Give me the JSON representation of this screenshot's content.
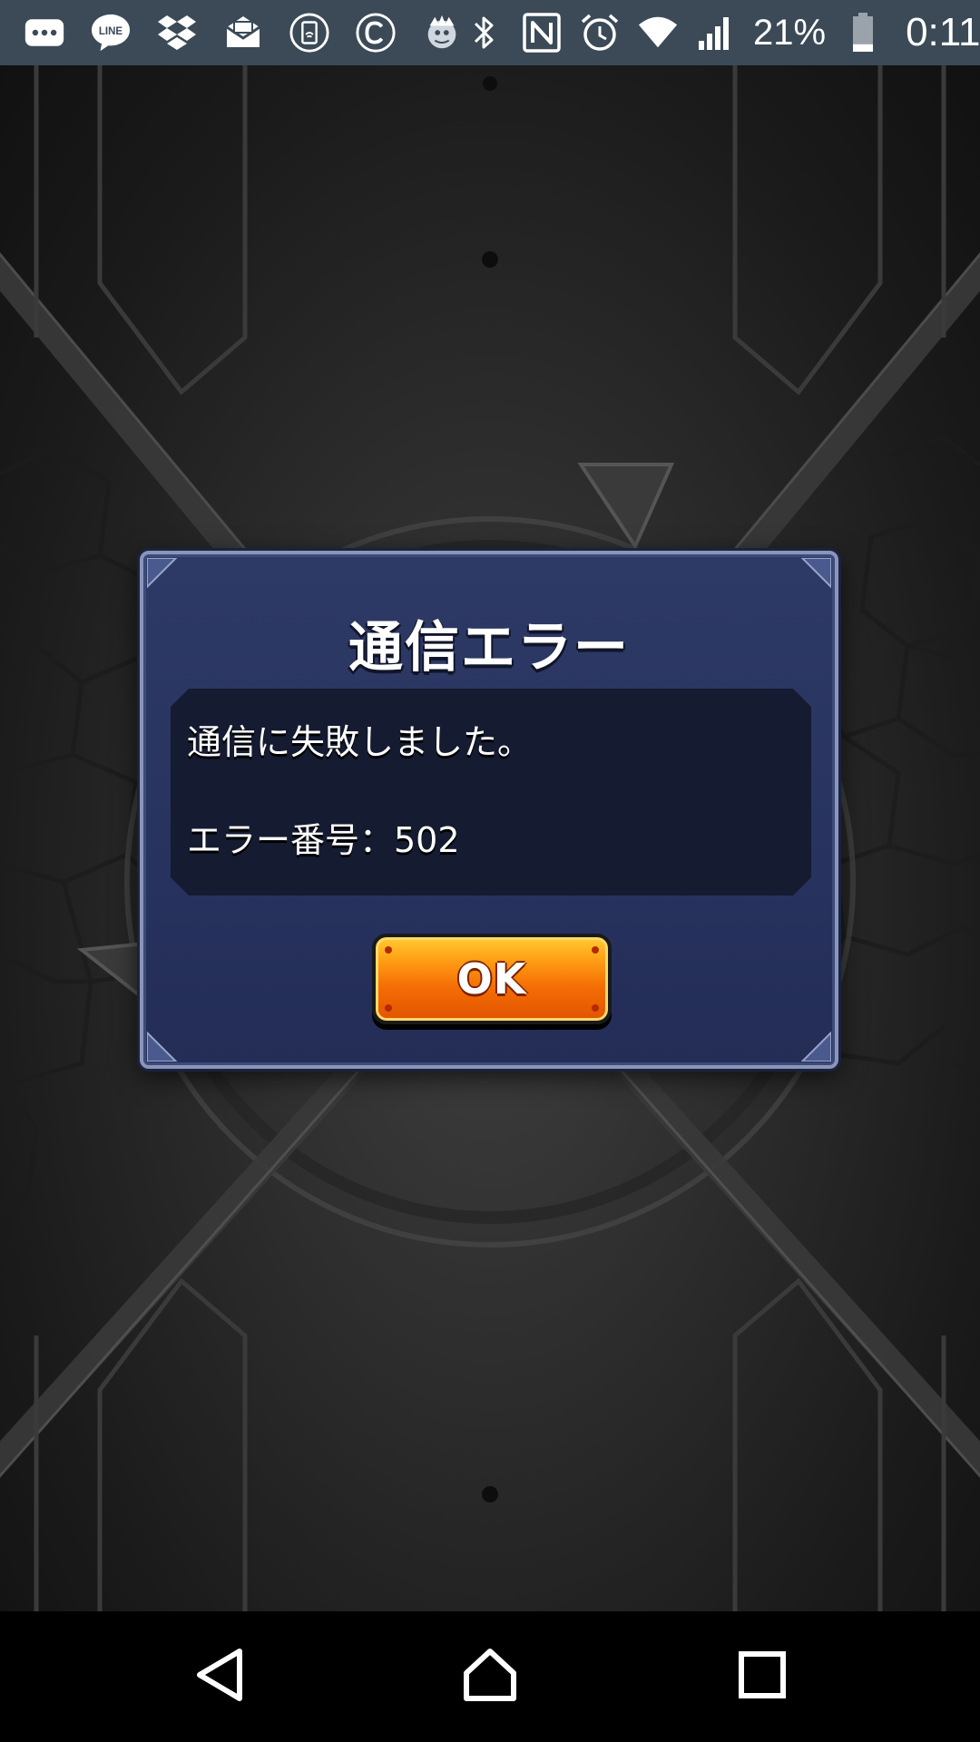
{
  "status_bar": {
    "notification_icons": [
      "more-notifications-icon",
      "line-app-icon",
      "dropbox-icon",
      "mail-icon",
      "nfc-pay-icon",
      "copyright-app-icon",
      "monster-app-icon"
    ],
    "system_icons": [
      "bluetooth-icon",
      "nfc-icon",
      "alarm-icon",
      "wifi-icon",
      "cellular-signal-icon"
    ],
    "line_icon_label": "LINE",
    "battery_percent": "21%",
    "battery_level": 0.21,
    "time": "0:11"
  },
  "dialog": {
    "title": "通信エラー",
    "message_line_1": "通信に失敗しました。",
    "message_line_2": "エラー番号：502",
    "ok_label": "OK"
  },
  "nav_bar": {
    "icons": [
      "back-icon",
      "home-icon",
      "recents-icon"
    ]
  },
  "colors": {
    "status_bar": "#3c4a57",
    "dialog_bg": "#2b3763",
    "dialog_border": "#8a96b8",
    "message_bg": "#151b30",
    "ok_button_top": "#ffcc33",
    "ok_button_bottom": "#e25300"
  }
}
